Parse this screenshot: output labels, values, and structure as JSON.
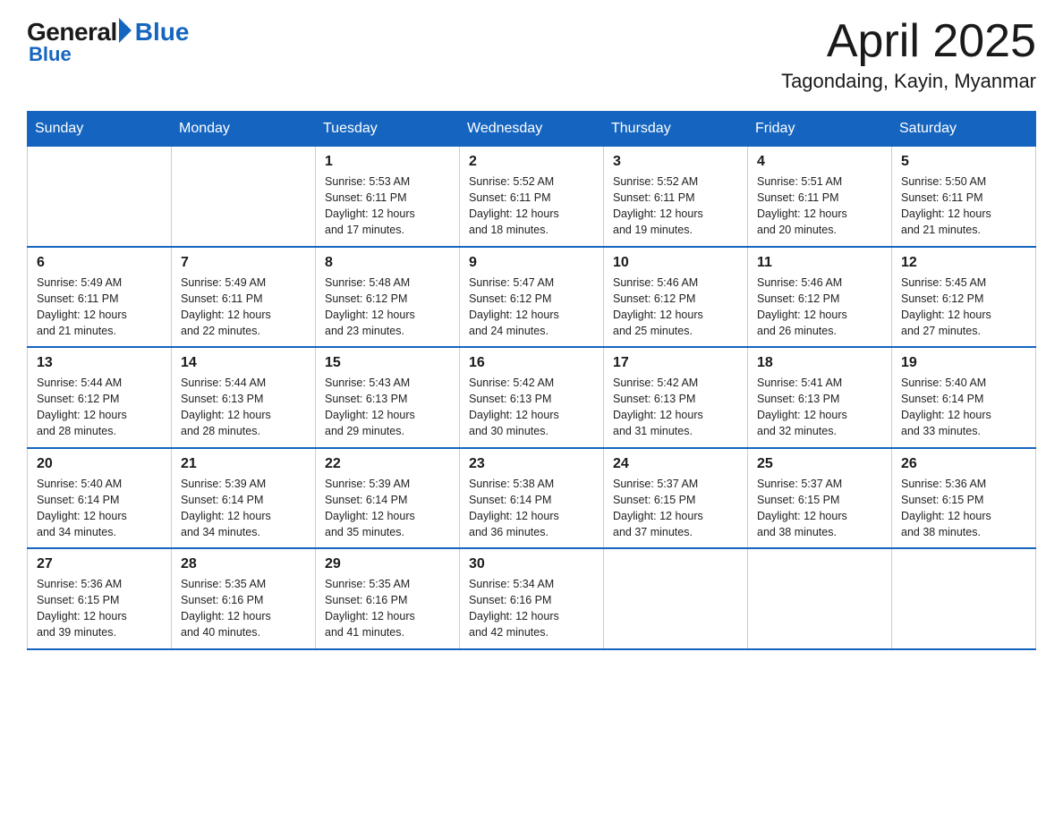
{
  "header": {
    "logo": {
      "general": "General",
      "blue": "Blue"
    },
    "month": "April 2025",
    "location": "Tagondaing, Kayin, Myanmar"
  },
  "weekdays": [
    "Sunday",
    "Monday",
    "Tuesday",
    "Wednesday",
    "Thursday",
    "Friday",
    "Saturday"
  ],
  "weeks": [
    [
      {
        "day": "",
        "info": ""
      },
      {
        "day": "",
        "info": ""
      },
      {
        "day": "1",
        "info": "Sunrise: 5:53 AM\nSunset: 6:11 PM\nDaylight: 12 hours\nand 17 minutes."
      },
      {
        "day": "2",
        "info": "Sunrise: 5:52 AM\nSunset: 6:11 PM\nDaylight: 12 hours\nand 18 minutes."
      },
      {
        "day": "3",
        "info": "Sunrise: 5:52 AM\nSunset: 6:11 PM\nDaylight: 12 hours\nand 19 minutes."
      },
      {
        "day": "4",
        "info": "Sunrise: 5:51 AM\nSunset: 6:11 PM\nDaylight: 12 hours\nand 20 minutes."
      },
      {
        "day": "5",
        "info": "Sunrise: 5:50 AM\nSunset: 6:11 PM\nDaylight: 12 hours\nand 21 minutes."
      }
    ],
    [
      {
        "day": "6",
        "info": "Sunrise: 5:49 AM\nSunset: 6:11 PM\nDaylight: 12 hours\nand 21 minutes."
      },
      {
        "day": "7",
        "info": "Sunrise: 5:49 AM\nSunset: 6:11 PM\nDaylight: 12 hours\nand 22 minutes."
      },
      {
        "day": "8",
        "info": "Sunrise: 5:48 AM\nSunset: 6:12 PM\nDaylight: 12 hours\nand 23 minutes."
      },
      {
        "day": "9",
        "info": "Sunrise: 5:47 AM\nSunset: 6:12 PM\nDaylight: 12 hours\nand 24 minutes."
      },
      {
        "day": "10",
        "info": "Sunrise: 5:46 AM\nSunset: 6:12 PM\nDaylight: 12 hours\nand 25 minutes."
      },
      {
        "day": "11",
        "info": "Sunrise: 5:46 AM\nSunset: 6:12 PM\nDaylight: 12 hours\nand 26 minutes."
      },
      {
        "day": "12",
        "info": "Sunrise: 5:45 AM\nSunset: 6:12 PM\nDaylight: 12 hours\nand 27 minutes."
      }
    ],
    [
      {
        "day": "13",
        "info": "Sunrise: 5:44 AM\nSunset: 6:12 PM\nDaylight: 12 hours\nand 28 minutes."
      },
      {
        "day": "14",
        "info": "Sunrise: 5:44 AM\nSunset: 6:13 PM\nDaylight: 12 hours\nand 28 minutes."
      },
      {
        "day": "15",
        "info": "Sunrise: 5:43 AM\nSunset: 6:13 PM\nDaylight: 12 hours\nand 29 minutes."
      },
      {
        "day": "16",
        "info": "Sunrise: 5:42 AM\nSunset: 6:13 PM\nDaylight: 12 hours\nand 30 minutes."
      },
      {
        "day": "17",
        "info": "Sunrise: 5:42 AM\nSunset: 6:13 PM\nDaylight: 12 hours\nand 31 minutes."
      },
      {
        "day": "18",
        "info": "Sunrise: 5:41 AM\nSunset: 6:13 PM\nDaylight: 12 hours\nand 32 minutes."
      },
      {
        "day": "19",
        "info": "Sunrise: 5:40 AM\nSunset: 6:14 PM\nDaylight: 12 hours\nand 33 minutes."
      }
    ],
    [
      {
        "day": "20",
        "info": "Sunrise: 5:40 AM\nSunset: 6:14 PM\nDaylight: 12 hours\nand 34 minutes."
      },
      {
        "day": "21",
        "info": "Sunrise: 5:39 AM\nSunset: 6:14 PM\nDaylight: 12 hours\nand 34 minutes."
      },
      {
        "day": "22",
        "info": "Sunrise: 5:39 AM\nSunset: 6:14 PM\nDaylight: 12 hours\nand 35 minutes."
      },
      {
        "day": "23",
        "info": "Sunrise: 5:38 AM\nSunset: 6:14 PM\nDaylight: 12 hours\nand 36 minutes."
      },
      {
        "day": "24",
        "info": "Sunrise: 5:37 AM\nSunset: 6:15 PM\nDaylight: 12 hours\nand 37 minutes."
      },
      {
        "day": "25",
        "info": "Sunrise: 5:37 AM\nSunset: 6:15 PM\nDaylight: 12 hours\nand 38 minutes."
      },
      {
        "day": "26",
        "info": "Sunrise: 5:36 AM\nSunset: 6:15 PM\nDaylight: 12 hours\nand 38 minutes."
      }
    ],
    [
      {
        "day": "27",
        "info": "Sunrise: 5:36 AM\nSunset: 6:15 PM\nDaylight: 12 hours\nand 39 minutes."
      },
      {
        "day": "28",
        "info": "Sunrise: 5:35 AM\nSunset: 6:16 PM\nDaylight: 12 hours\nand 40 minutes."
      },
      {
        "day": "29",
        "info": "Sunrise: 5:35 AM\nSunset: 6:16 PM\nDaylight: 12 hours\nand 41 minutes."
      },
      {
        "day": "30",
        "info": "Sunrise: 5:34 AM\nSunset: 6:16 PM\nDaylight: 12 hours\nand 42 minutes."
      },
      {
        "day": "",
        "info": ""
      },
      {
        "day": "",
        "info": ""
      },
      {
        "day": "",
        "info": ""
      }
    ]
  ]
}
